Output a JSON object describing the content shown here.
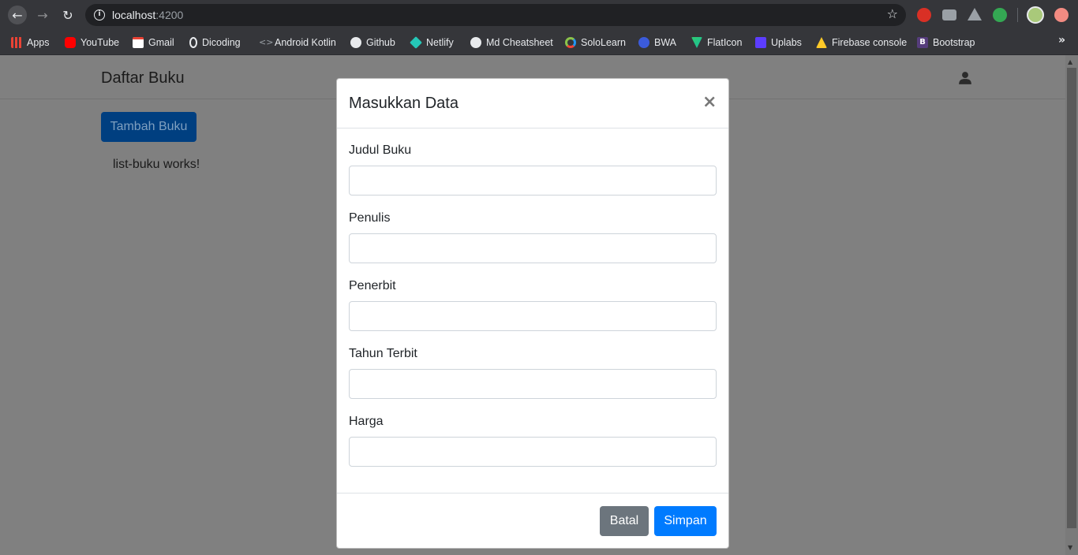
{
  "browser": {
    "url_host": "localhost",
    "url_port": ":4200",
    "bookmarks": [
      {
        "label": "Apps",
        "icon": "apps-grid-icon",
        "color": "#ea4335"
      },
      {
        "label": "YouTube",
        "icon": "youtube-icon",
        "color": "#ff0000"
      },
      {
        "label": "Gmail",
        "icon": "gmail-icon",
        "color": "#ea4335"
      },
      {
        "label": "Dicoding",
        "icon": "dicoding-icon",
        "color": "#e8eaed"
      },
      {
        "label": "Android Kotlin",
        "icon": "code-icon",
        "color": "#9aa0a6"
      },
      {
        "label": "Github",
        "icon": "github-icon",
        "color": "#e8eaed"
      },
      {
        "label": "Netlify",
        "icon": "netlify-icon",
        "color": "#25c7b7"
      },
      {
        "label": "Md Cheatsheet",
        "icon": "github-icon",
        "color": "#e8eaed"
      },
      {
        "label": "SoloLearn",
        "icon": "sololearn-icon",
        "color": "#8bc34a"
      },
      {
        "label": "BWA",
        "icon": "bwa-icon",
        "color": "#3b5bdb"
      },
      {
        "label": "FlatIcon",
        "icon": "flaticon-icon",
        "color": "#2ecc71"
      },
      {
        "label": "Uplabs",
        "icon": "uplabs-icon",
        "color": "#5c3dff"
      },
      {
        "label": "Firebase console",
        "icon": "firebase-icon",
        "color": "#ffca28"
      },
      {
        "label": "Bootstrap",
        "icon": "bootstrap-icon",
        "color": "#563d7c"
      }
    ]
  },
  "navbar": {
    "brand": "Daftar Buku"
  },
  "main": {
    "add_button_label": "Tambah Buku",
    "works_text": "list-buku works!"
  },
  "modal": {
    "title": "Masukkan Data",
    "close_glyph": "×",
    "fields": [
      {
        "label": "Judul Buku",
        "value": ""
      },
      {
        "label": "Penulis",
        "value": ""
      },
      {
        "label": "Penerbit",
        "value": ""
      },
      {
        "label": "Tahun Terbit",
        "value": ""
      },
      {
        "label": "Harga",
        "value": ""
      }
    ],
    "cancel_label": "Batal",
    "save_label": "Simpan"
  }
}
